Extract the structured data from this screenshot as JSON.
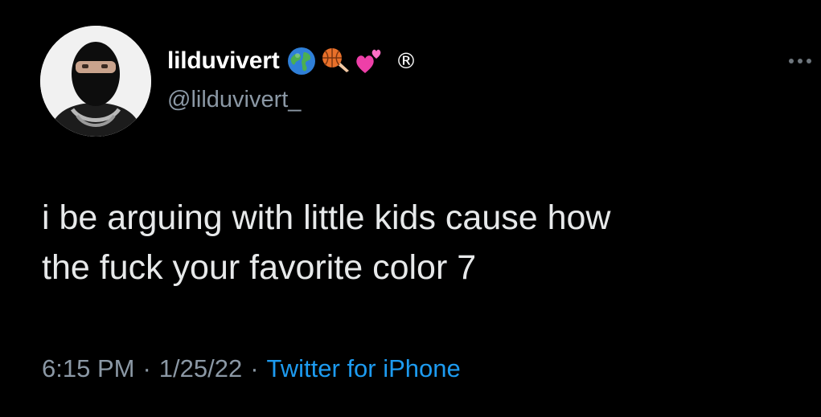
{
  "tweet": {
    "author": {
      "display_name": "lilduvivert",
      "handle": "@lilduvivert_",
      "badges": [
        "globe-emoji",
        "basketball-emoji",
        "hearts-emoji"
      ],
      "registered_mark": "®"
    },
    "text": "i be arguing with little kids cause how\nthe fuck your favorite color 7",
    "time": "6:15 PM",
    "date": "1/25/22",
    "separator": "·",
    "source": "Twitter for iPhone"
  },
  "colors": {
    "background": "#000000",
    "text_primary": "#e7e9ea",
    "text_secondary": "#8b98a5",
    "link": "#1d9bf0"
  }
}
